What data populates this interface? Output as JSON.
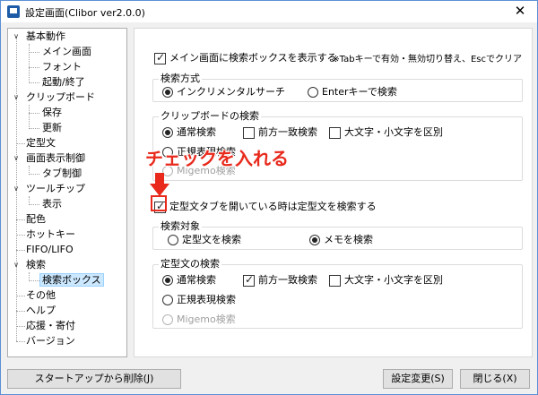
{
  "window": {
    "title": "設定画面(Clibor ver2.0.0)",
    "close_glyph": "✕"
  },
  "tree": {
    "items": [
      {
        "label": "基本動作",
        "level": 0,
        "expanded": true
      },
      {
        "label": "メイン画面",
        "level": 1
      },
      {
        "label": "フォント",
        "level": 1
      },
      {
        "label": "起動/終了",
        "level": 1
      },
      {
        "label": "クリップボード",
        "level": 0,
        "expanded": true
      },
      {
        "label": "保存",
        "level": 1
      },
      {
        "label": "更新",
        "level": 1
      },
      {
        "label": "定型文",
        "level": 0
      },
      {
        "label": "画面表示制御",
        "level": 0,
        "expanded": true
      },
      {
        "label": "タブ制御",
        "level": 1
      },
      {
        "label": "ツールチップ",
        "level": 0,
        "expanded": true
      },
      {
        "label": "表示",
        "level": 1
      },
      {
        "label": "配色",
        "level": 0
      },
      {
        "label": "ホットキー",
        "level": 0
      },
      {
        "label": "FIFO/LIFO",
        "level": 0
      },
      {
        "label": "検索",
        "level": 0,
        "expanded": true
      },
      {
        "label": "検索ボックス",
        "level": 1,
        "selected": true
      },
      {
        "label": "その他",
        "level": 0
      },
      {
        "label": "ヘルプ",
        "level": 0
      },
      {
        "label": "応援・寄付",
        "level": 0
      },
      {
        "label": "バージョン",
        "level": 0
      }
    ]
  },
  "panel": {
    "show_searchbox": {
      "label": "メイン画面に検索ボックスを表示する",
      "checked": true
    },
    "note": "※Tabキーで有効・無効切り替え、Escでクリア",
    "search_method": {
      "title": "検索方式",
      "incremental": {
        "label": "インクリメンタルサーチ",
        "checked": true
      },
      "enter": {
        "label": "Enterキーで検索",
        "checked": false
      }
    },
    "clipboard_search": {
      "title": "クリップボードの検索",
      "normal": {
        "label": "通常検索",
        "checked": true
      },
      "prefix": {
        "label": "前方一致検索",
        "checked": false
      },
      "case": {
        "label": "大文字・小文字を区別",
        "checked": false
      },
      "regex": {
        "label": "正規表現検索",
        "checked": false
      },
      "migemo": {
        "label": "Migemo検索",
        "checked": false
      }
    },
    "template_tab": {
      "label": "定型文タブを開いている時は定型文を検索する",
      "checked": true
    },
    "search_target": {
      "title": "検索対象",
      "template": {
        "label": "定型文を検索",
        "checked": false
      },
      "memo": {
        "label": "メモを検索",
        "checked": true
      }
    },
    "template_search": {
      "title": "定型文の検索",
      "normal": {
        "label": "通常検索",
        "checked": true
      },
      "prefix": {
        "label": "前方一致検索",
        "checked": true
      },
      "case": {
        "label": "大文字・小文字を区別",
        "checked": false
      },
      "regex": {
        "label": "正規表現検索",
        "checked": false
      },
      "migemo": {
        "label": "Migemo検索",
        "checked": false
      }
    }
  },
  "annotation": {
    "text": "チェックを入れる",
    "color": "#e8291c"
  },
  "buttons": {
    "startup_remove": "スタートアップから削除(J)",
    "apply": "設定変更(S)",
    "close": "閉じる(X)"
  }
}
